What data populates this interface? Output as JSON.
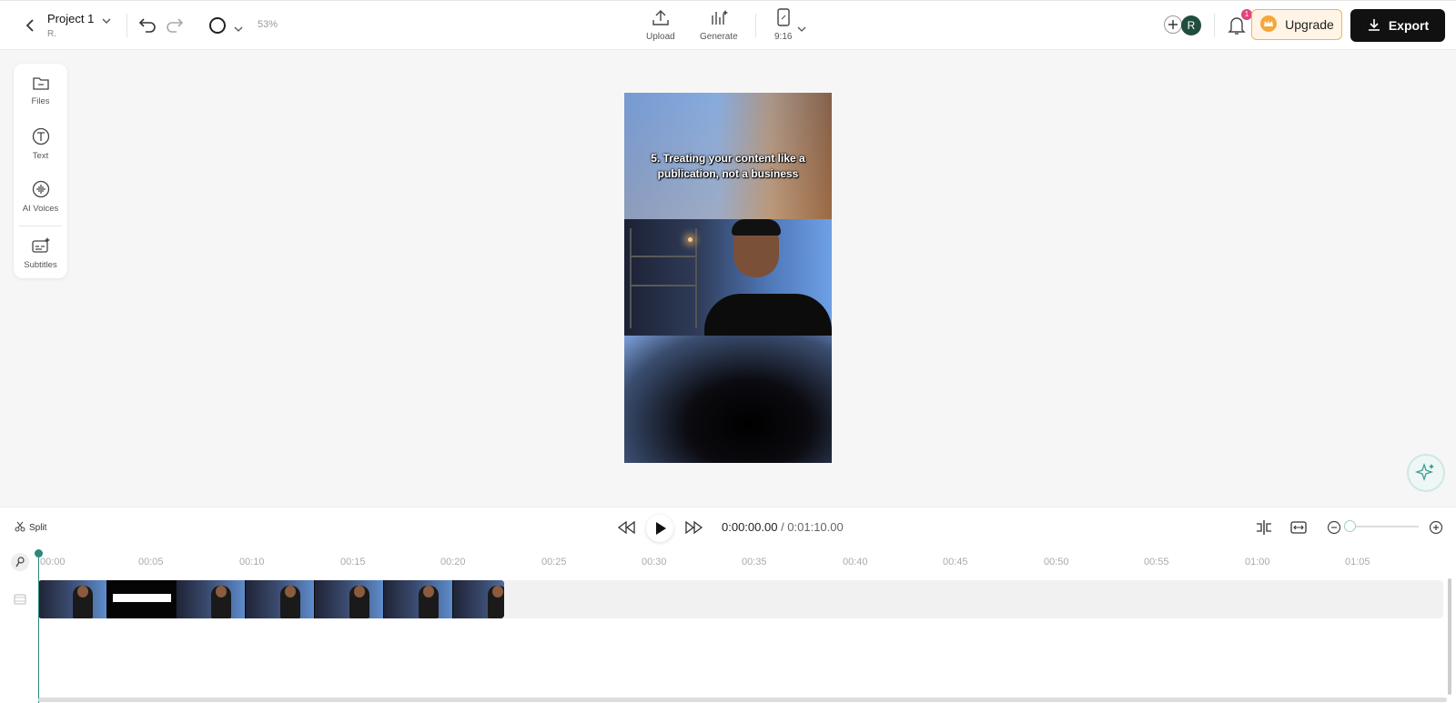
{
  "header": {
    "project_name": "Project 1",
    "owner": "R.",
    "zoom_percent": "53%",
    "tools": {
      "upload": "Upload",
      "generate": "Generate",
      "aspect": "9:16"
    },
    "avatar_initial": "R",
    "notification_count": "1",
    "upgrade_label": "Upgrade",
    "export_label": "Export"
  },
  "sidebar": {
    "items": [
      {
        "label": "Files",
        "icon": "folder-icon"
      },
      {
        "label": "Text",
        "icon": "text-icon"
      },
      {
        "label": "AI Voices",
        "icon": "voice-wave-icon"
      },
      {
        "label": "Subtitles",
        "icon": "subtitles-icon"
      }
    ]
  },
  "preview": {
    "caption": "5. Treating your content like a publication, not a business"
  },
  "controls": {
    "split_label": "Split",
    "current_time": "0:00:00.00",
    "total_time": " / 0:01:10.00"
  },
  "timeline": {
    "ticks": [
      "00:00",
      "00:05",
      "00:10",
      "00:15",
      "00:20",
      "00:25",
      "00:30",
      "00:35",
      "00:40",
      "00:45",
      "00:50",
      "00:55",
      "01:00",
      "01:05"
    ]
  },
  "colors": {
    "accent": "#2b8a7a",
    "upgrade_border": "#f0b35a",
    "export_bg": "#111111",
    "badge": "#e0457b"
  }
}
